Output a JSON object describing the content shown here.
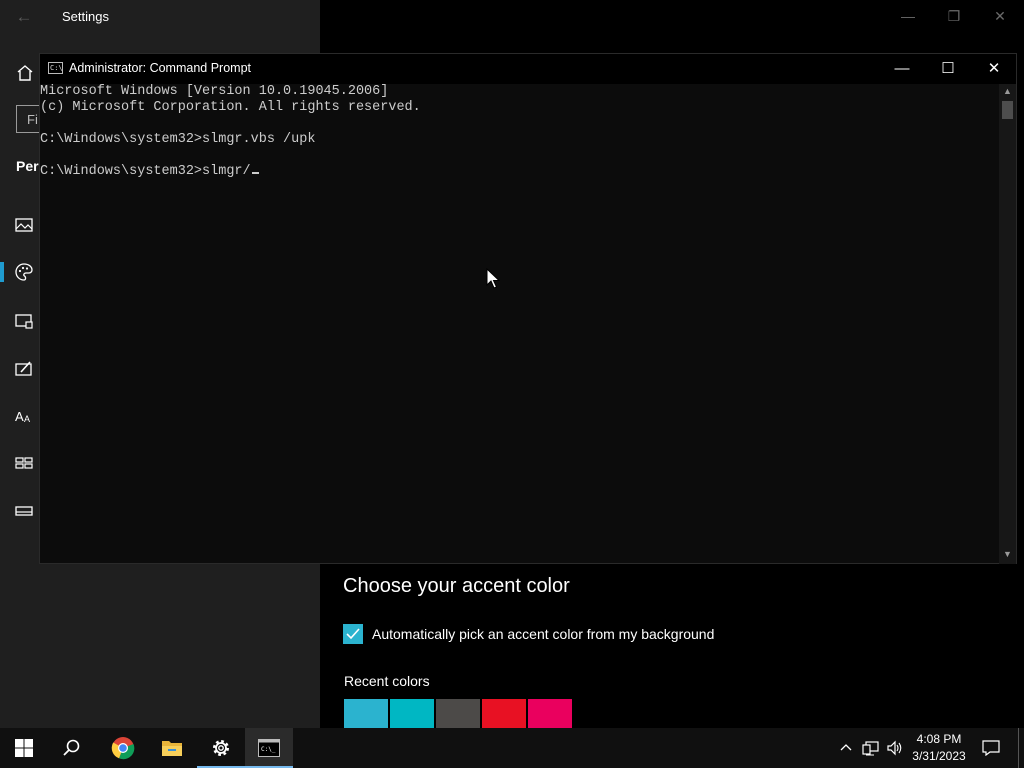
{
  "settings": {
    "title": "Settings",
    "search_placeholder": "Fi",
    "section_label": "Pers",
    "accent": {
      "heading": "Choose your accent color",
      "auto_pick_label": "Automatically pick an accent color from my background",
      "auto_pick_checked": true,
      "recent_label": "Recent colors",
      "recent_colors": [
        "#2bb3cf",
        "#00b7c3",
        "#4c4a48",
        "#e81123",
        "#ea005e"
      ]
    },
    "nav_icons": [
      "home-icon",
      "picture-icon",
      "palette-icon",
      "lock-screen-icon",
      "themes-icon",
      "fonts-icon",
      "start-icon",
      "taskbar-icon"
    ],
    "accent_color": "#1f9bcf"
  },
  "cmd": {
    "title": "Administrator: Command Prompt",
    "lines": [
      "Microsoft Windows [Version 10.0.19045.2006]",
      "(c) Microsoft Corporation. All rights reserved.",
      "",
      "C:\\Windows\\system32>slmgr.vbs /upk",
      "",
      "C:\\Windows\\system32>slmgr/"
    ]
  },
  "taskbar": {
    "apps": [
      "start-icon",
      "search-icon",
      "chrome-icon",
      "file-explorer-icon",
      "settings-icon",
      "command-prompt-icon"
    ],
    "time": "4:08 PM",
    "date": "3/31/2023"
  }
}
